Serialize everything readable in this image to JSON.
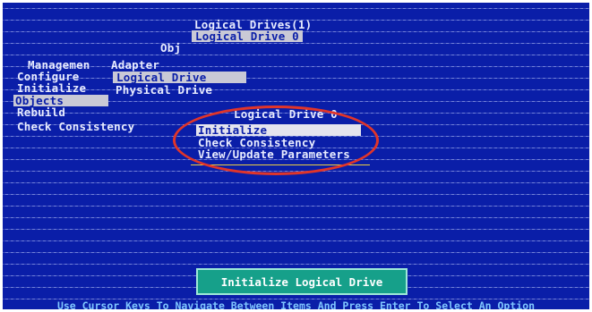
{
  "header": {
    "title": "Logical Drives(1)",
    "selected_drive": "Logical Drive 0",
    "obj_label": "Obj"
  },
  "main_menu": {
    "items": [
      {
        "label": "Managemen"
      },
      {
        "label": "Configure"
      },
      {
        "label": "Initialize"
      },
      {
        "label": "Objects"
      },
      {
        "label": "Rebuild"
      },
      {
        "label": "Check Consistency"
      }
    ]
  },
  "objects_menu": {
    "items": [
      {
        "label": "Adapter"
      },
      {
        "label": "Logical Drive"
      },
      {
        "label": "Physical Drive"
      }
    ]
  },
  "popup": {
    "title": "Logical Drive 0",
    "items": [
      {
        "label": "Initialize"
      },
      {
        "label": "Check Consistency"
      },
      {
        "label": "View/Update Parameters"
      }
    ]
  },
  "action_banner": {
    "label": "Initialize Logical Drive"
  },
  "status_bar": {
    "text": "Use Cursor Keys To Navigate Between Items And Press Enter To Select An Option"
  },
  "colors": {
    "background": "#0a1ea8",
    "highlight": "#c9c9d6",
    "banner": "#16a08a",
    "annotation": "#e0352a"
  }
}
